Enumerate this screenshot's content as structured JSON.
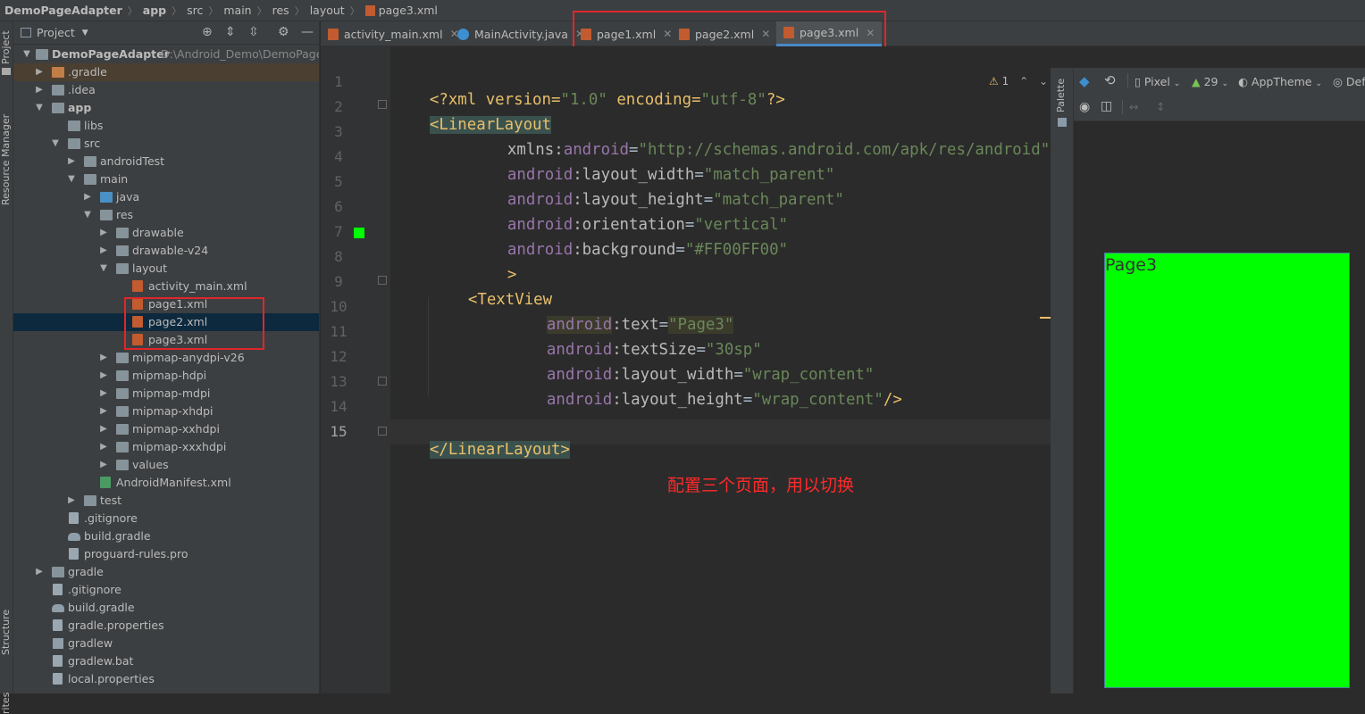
{
  "breadcrumb": [
    "DemoPageAdapter",
    "app",
    "src",
    "main",
    "res",
    "layout",
    "page3.xml"
  ],
  "side_labels": {
    "project": "Project",
    "resource_manager": "Resource Manager",
    "structure": "Structure",
    "favorites": "rites",
    "palette": "Palette"
  },
  "project_panel": {
    "title": "Project"
  },
  "tree": [
    {
      "label": "DemoPageAdapter",
      "path": "D:\\Android_Demo\\DemoPageA",
      "bold": true
    },
    {
      "label": ".gradle"
    },
    {
      "label": ".idea"
    },
    {
      "label": "app",
      "bold": true
    },
    {
      "label": "libs"
    },
    {
      "label": "src"
    },
    {
      "label": "androidTest"
    },
    {
      "label": "main"
    },
    {
      "label": "java"
    },
    {
      "label": "res"
    },
    {
      "label": "drawable"
    },
    {
      "label": "drawable-v24"
    },
    {
      "label": "layout"
    },
    {
      "label": "activity_main.xml"
    },
    {
      "label": "page1.xml"
    },
    {
      "label": "page2.xml"
    },
    {
      "label": "page3.xml"
    },
    {
      "label": "mipmap-anydpi-v26"
    },
    {
      "label": "mipmap-hdpi"
    },
    {
      "label": "mipmap-mdpi"
    },
    {
      "label": "mipmap-xhdpi"
    },
    {
      "label": "mipmap-xxhdpi"
    },
    {
      "label": "mipmap-xxxhdpi"
    },
    {
      "label": "values"
    },
    {
      "label": "AndroidManifest.xml"
    },
    {
      "label": "test"
    },
    {
      "label": ".gitignore"
    },
    {
      "label": "build.gradle"
    },
    {
      "label": "proguard-rules.pro"
    },
    {
      "label": "gradle"
    },
    {
      "label": ".gitignore"
    },
    {
      "label": "build.gradle"
    },
    {
      "label": "gradle.properties"
    },
    {
      "label": "gradlew"
    },
    {
      "label": "gradlew.bat"
    },
    {
      "label": "local.properties"
    }
  ],
  "tabs": [
    {
      "label": "activity_main.xml"
    },
    {
      "label": "MainActivity.java"
    },
    {
      "label": "page1.xml"
    },
    {
      "label": "page2.xml"
    },
    {
      "label": "page3.xml",
      "active": true
    }
  ],
  "editor": {
    "line_numbers": [
      "1",
      "2",
      "3",
      "4",
      "5",
      "6",
      "7",
      "8",
      "9",
      "10",
      "11",
      "12",
      "13",
      "14",
      "15"
    ],
    "warnings": "1",
    "code": {
      "l1_a": "<?xml version=",
      "l1_b": "\"1.0\"",
      "l1_c": " encoding=",
      "l1_d": "\"utf-8\"",
      "l1_e": "?>",
      "l2_tag": "<LinearLayout",
      "l3_ns": "xmlns:",
      "l3_attr": "android",
      "l3_eq": "=",
      "l3_val": "\"http://schemas.android.com/apk/res/android\"",
      "ns": "android",
      "colon": ":",
      "eq": "=",
      "l4_attr": "layout_width",
      "l4_val": "\"match_parent\"",
      "l5_attr": "layout_height",
      "l5_val": "\"match_parent\"",
      "l6_attr": "orientation",
      "l6_val": "\"vertical\"",
      "l7_attr": "background",
      "l7_val": "\"#FF00FF00\"",
      "l8": ">",
      "l9_tag": "<TextView",
      "l10_attr": "text",
      "l10_val": "\"Page3\"",
      "l11_attr": "textSize",
      "l11_val": "\"30sp\"",
      "l12_attr": "layout_width",
      "l12_val": "\"wrap_content\"",
      "l13_attr": "layout_height",
      "l13_val": "\"wrap_content\"",
      "l13_end": "/>",
      "l15_tag": "</LinearLayout>"
    }
  },
  "annotation": "配置三个页面，用以切换",
  "preview": {
    "device": "Pixel",
    "api": "29",
    "theme": "AppTheme",
    "locale": "Def",
    "text": "Page3",
    "background": "#00FF00"
  }
}
